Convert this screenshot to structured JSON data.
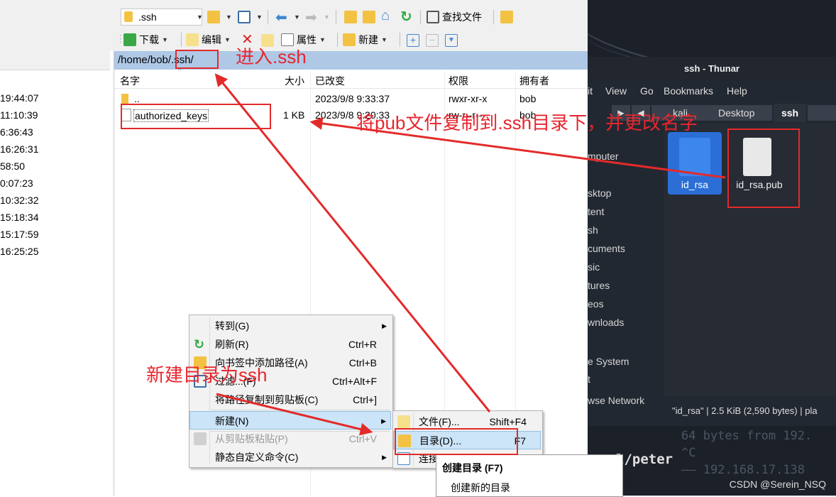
{
  "toolbar": {
    "path_combo": ".ssh",
    "find_files": "查找文件",
    "download": "下载",
    "edit": "编辑",
    "properties": "属性",
    "new": "新建"
  },
  "left_pane": {
    "times": [
      "19:44:07",
      "11:10:39",
      "6:36:43",
      "16:26:31",
      "58:50",
      "0:07:23",
      "10:32:32",
      "15:18:34",
      "15:17:59",
      "16:25:25"
    ]
  },
  "remote": {
    "path": "/home/bob/.ssh/",
    "columns": {
      "name": "名字",
      "size": "大小",
      "modified": "已改变",
      "perms": "权限",
      "owner": "拥有者"
    },
    "rows": [
      {
        "name": "..",
        "size": "",
        "modified": "2023/9/8 9:33:37",
        "perms": "rwxr-xr-x",
        "owner": "bob"
      },
      {
        "name": "authorized_keys",
        "size": "1 KB",
        "modified": "2023/9/8 9:20:33",
        "perms": "rw-r--r--",
        "owner": "bob"
      }
    ]
  },
  "context_menu": {
    "items": [
      {
        "label": "转到(G)",
        "shortcut": "",
        "submenu": true
      },
      {
        "label": "刷新(R)",
        "shortcut": "Ctrl+R"
      },
      {
        "label": "向书签中添加路径(A)",
        "shortcut": "Ctrl+B"
      },
      {
        "label": "过滤...(F)",
        "shortcut": "Ctrl+Alt+F"
      },
      {
        "label": "将路径复制到剪贴板(C)",
        "shortcut": "Ctrl+]"
      },
      {
        "label": "新建(N)",
        "shortcut": "",
        "submenu": true
      },
      {
        "label": "从剪贴板粘贴(P)",
        "shortcut": "Ctrl+V"
      },
      {
        "label": "静态自定义命令(C)",
        "shortcut": "",
        "submenu": true
      }
    ]
  },
  "submenu": {
    "items": [
      {
        "label": "文件(F)...",
        "shortcut": "Shift+F4"
      },
      {
        "label": "目录(D)...",
        "shortcut": "F7"
      },
      {
        "label": "连接",
        "shortcut": ""
      }
    ]
  },
  "tooltip": {
    "title": "创建目录 (F7)",
    "desc": "创建新的目录"
  },
  "thunar": {
    "title": "ssh - Thunar",
    "menu": [
      "it",
      "View",
      "Go",
      "Bookmarks",
      "Help"
    ],
    "path": [
      "kali",
      "Desktop",
      "ssh"
    ],
    "sidebar": [
      "mputer",
      "sktop",
      "tent",
      "sh",
      "cuments",
      "sic",
      "tures",
      "eos",
      "wnloads",
      "e System",
      "t",
      "wse Network"
    ],
    "files": [
      {
        "name": "id_rsa",
        "selected": true
      },
      {
        "name": "id_rsa.pub",
        "selected": false
      }
    ],
    "status": "\"id_rsa\" | 2.5 KiB (2,590 bytes) | pla"
  },
  "terminal": {
    "line1": "64 bytes from 192.",
    "line2": "^C",
    "line3": "—— 192.168.17.138",
    "prompt_tail": "l/peter"
  },
  "annotations": {
    "enter_ssh": "进入.ssh",
    "copy_pub": "将pub文件复制到.ssh目录下，并更改名字",
    "new_dir": "新建目录为ssh",
    "watermark": "CSDN @Serein_NSQ"
  },
  "colors": {
    "annotation": "#e8262e",
    "path_bar": "#aec8e6",
    "highlight": "#cce4f7",
    "thunar_bg": "#222831"
  }
}
